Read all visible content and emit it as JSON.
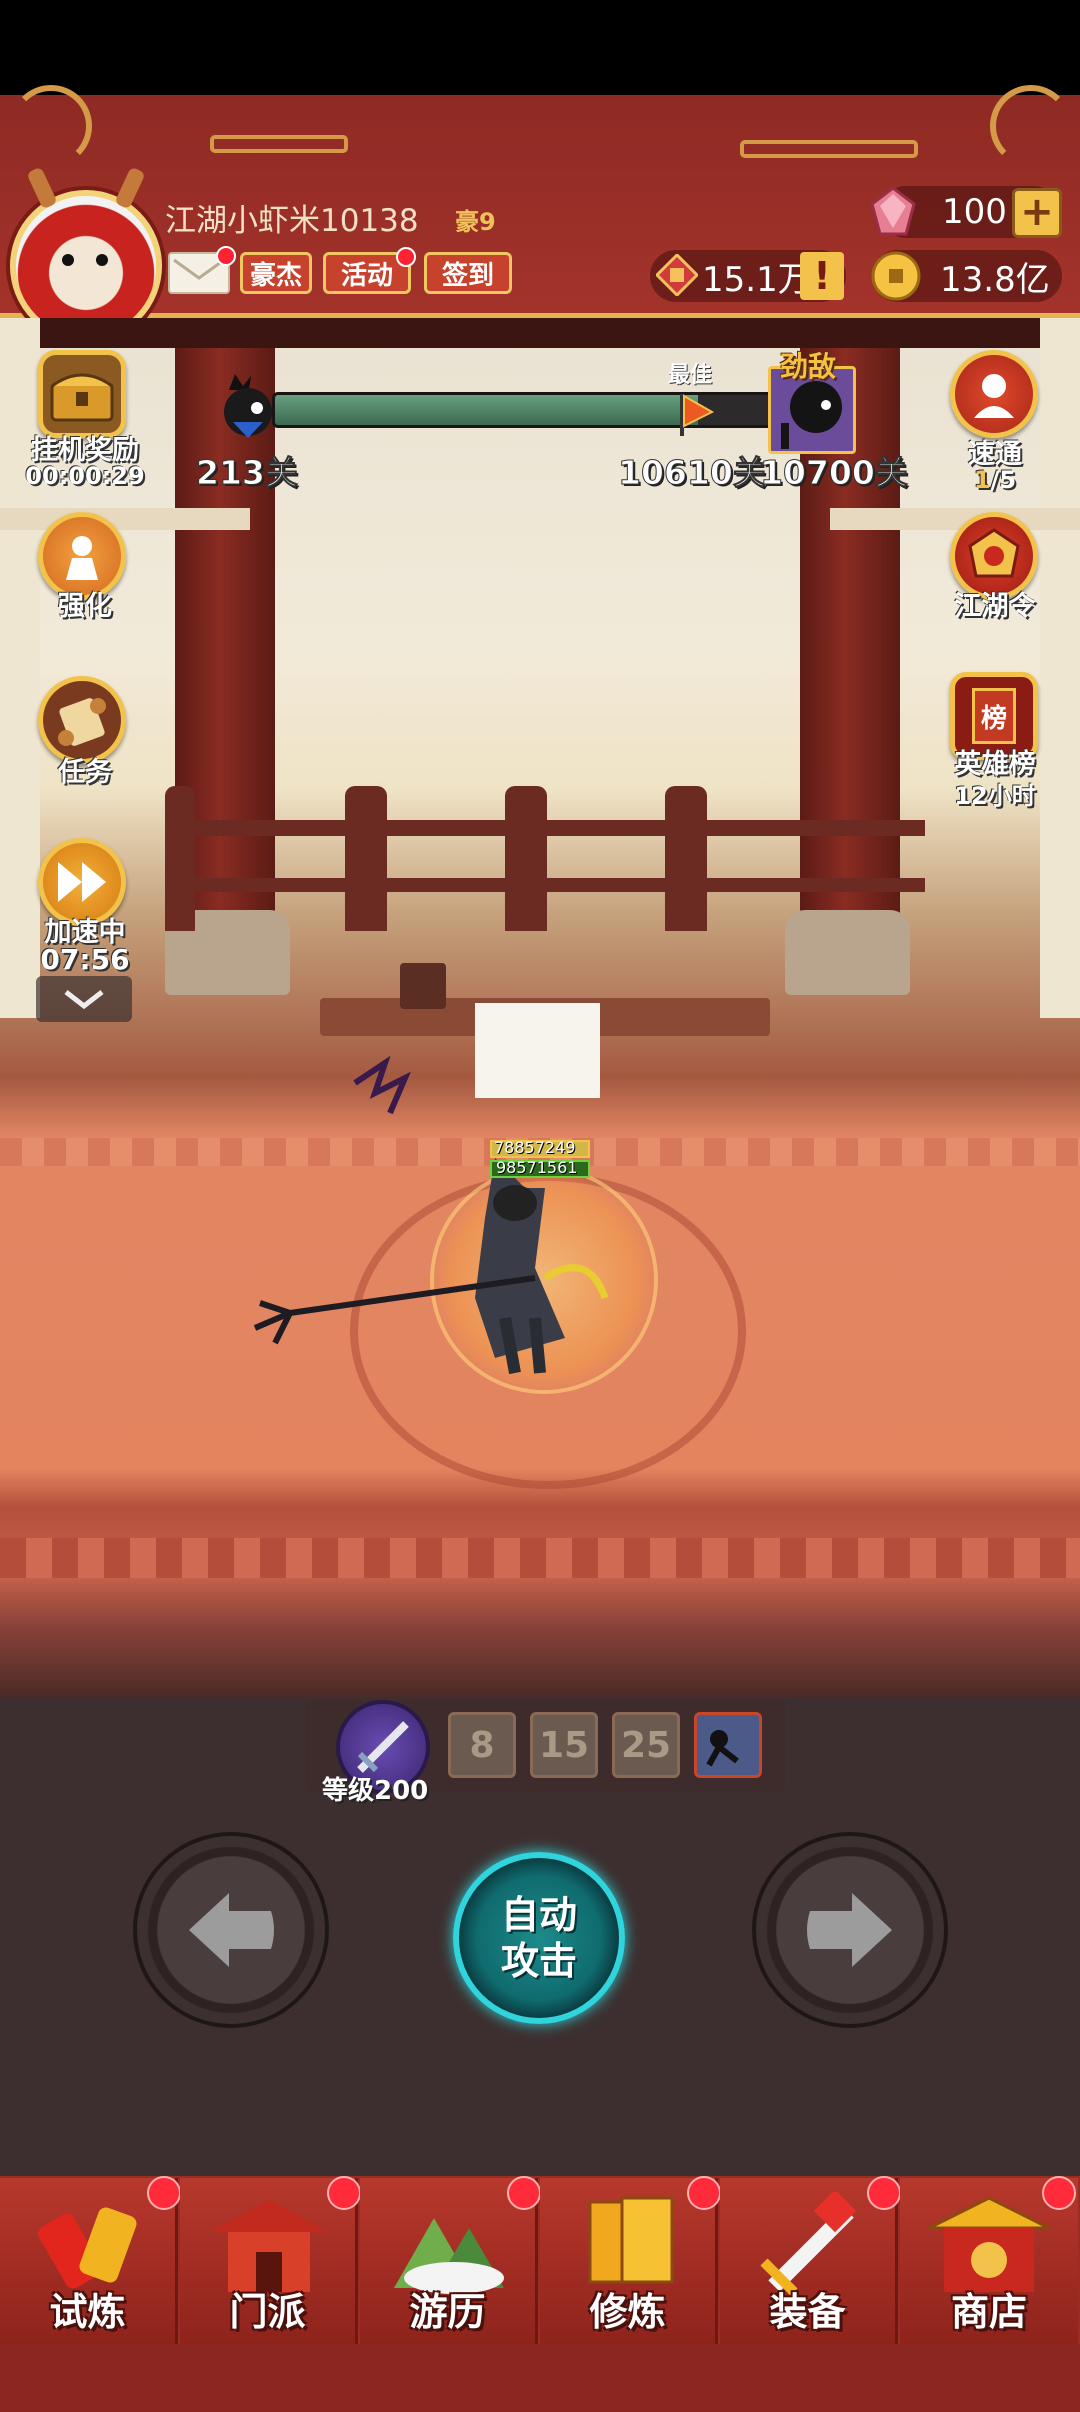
{
  "header": {
    "player_name": "江湖小虾米10138",
    "vip_label": "豪9",
    "buttons": {
      "hero": "豪杰",
      "activity": "活动",
      "signin": "签到"
    },
    "resources": {
      "gems": "100",
      "honor": "15.1万",
      "gold": "13.8亿"
    },
    "colors": {
      "header_bg": "#9e3029",
      "accent_gold": "#e4b24e"
    }
  },
  "progress": {
    "current_stage": "213关",
    "best_label": "最佳",
    "best_stage": "10610关",
    "boss_label": "劲敌",
    "boss_stage": "10700关",
    "fill_fraction": 0.84
  },
  "left_menu": {
    "idle_reward": {
      "label": "挂机奖励",
      "timer": "00:00:29"
    },
    "strengthen": {
      "label": "强化"
    },
    "quest": {
      "label": "任务"
    },
    "speedup": {
      "label": "加速中",
      "timer": "07:56"
    }
  },
  "right_menu": {
    "sweep": {
      "label": "速通",
      "count_current": "1",
      "count_total": "/5"
    },
    "jianghu_order": {
      "label": "江湖令"
    },
    "hero_rank": {
      "label": "英雄榜",
      "banner_char": "榜",
      "sub": "12小时"
    }
  },
  "battle": {
    "hp_value": "78857249",
    "shield_value": "98571561"
  },
  "skills": {
    "level_label": "等级200",
    "locked_slots": [
      "8",
      "15",
      "25"
    ]
  },
  "controls": {
    "auto_attack": "自动攻击"
  },
  "bottom_nav": [
    {
      "label": "试炼",
      "dot": true
    },
    {
      "label": "门派",
      "dot": true
    },
    {
      "label": "游历",
      "dot": true
    },
    {
      "label": "修炼",
      "dot": true
    },
    {
      "label": "装备",
      "dot": true
    },
    {
      "label": "商店",
      "dot": true
    }
  ]
}
